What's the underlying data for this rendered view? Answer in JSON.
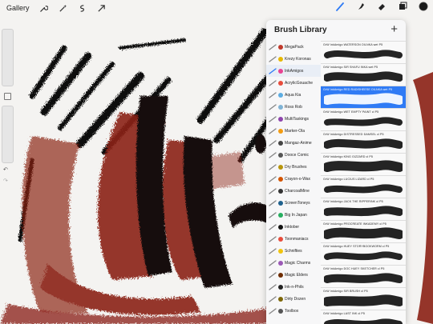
{
  "topbar": {
    "gallery_label": "Gallery",
    "left_tools": [
      "wrench-icon",
      "magic-wand-icon",
      "selection-icon",
      "transform-arrow-icon"
    ],
    "right_tools": [
      "brush-icon",
      "smudge-icon",
      "eraser-icon",
      "layers-icon",
      "color-icon"
    ],
    "active_color": "#1a1a1a",
    "accent": "#2f7bf5"
  },
  "panel": {
    "title": "Brush Library",
    "add_label": "+",
    "categories": [
      {
        "label": "MegaPack",
        "color": "#c0392b"
      },
      {
        "label": "Krezy Koronas",
        "color": "#e6b800"
      },
      {
        "label": "InkAmigos",
        "color": "#e84393"
      },
      {
        "label": "AcrylicGouache",
        "color": "#e74c3c"
      },
      {
        "label": "Aqua Kia",
        "color": "#5dade2"
      },
      {
        "label": "Ross Rob",
        "color": "#7fb3d5"
      },
      {
        "label": "MultiTaskings",
        "color": "#8e44ad"
      },
      {
        "label": "Marker-Ola",
        "color": "#f39c12"
      },
      {
        "label": "Mangaz-Anime",
        "color": "#444444"
      },
      {
        "label": "Dooce Comic",
        "color": "#555555"
      },
      {
        "label": "Dry Brushes",
        "color": "#b7950b"
      },
      {
        "label": "Crayon-o-Wax",
        "color": "#d35400"
      },
      {
        "label": "CharcoalMine",
        "color": "#333333"
      },
      {
        "label": "ScreenToneys",
        "color": "#1f618d"
      },
      {
        "label": "Big In Japan",
        "color": "#27ae60"
      },
      {
        "label": "Inktober",
        "color": "#111111"
      },
      {
        "label": "Toonmaniacs",
        "color": "#e74c3c"
      },
      {
        "label": "Schnifties",
        "color": "#f1c40f"
      },
      {
        "label": "Magic Charms",
        "color": "#9b59b6"
      },
      {
        "label": "Magic Elders",
        "color": "#6e2c00"
      },
      {
        "label": "Ink-n-Phils",
        "color": "#222222"
      },
      {
        "label": "Dirty Dozen",
        "color": "#7d6608"
      },
      {
        "label": "Toolbox",
        "color": "#555555"
      }
    ],
    "selected_category": 2,
    "brushes": [
      {
        "label": "GrW InkAmigo WATERSON OILNKA wet P5"
      },
      {
        "label": "GrW InkAmigo SIR SHAFU INKA wet P5"
      },
      {
        "label": "GrW InkAmigo RED RADISHEESE OILNKA wet P5"
      },
      {
        "label": "GrW InkAmigo WET EMPTY PAINT cl P5"
      },
      {
        "label": "GrW InkAmigo DISTRESSED DAMSEL cl P5"
      },
      {
        "label": "GrW InkAmigo KING GIZZARD cl P5"
      },
      {
        "label": "GrW InkAmigo LUCIUS LIZARD cl P5"
      },
      {
        "label": "GrW InkAmigo JACK THE RIPPERINK cl P5"
      },
      {
        "label": "GrW InkAmigo PROCREATE INKADEMY cl P5"
      },
      {
        "label": "GrW InkAmigo HUEY STORYBOOKWORM cl P5"
      },
      {
        "label": "GrW InkAmigo DOC HUEY SKETCHER cl P5"
      },
      {
        "label": "GrW InkAmigo SIR BRUSH cl P5"
      },
      {
        "label": "GrW InkAmigo LAST INK cl P5"
      }
    ],
    "selected_brush": 2
  }
}
